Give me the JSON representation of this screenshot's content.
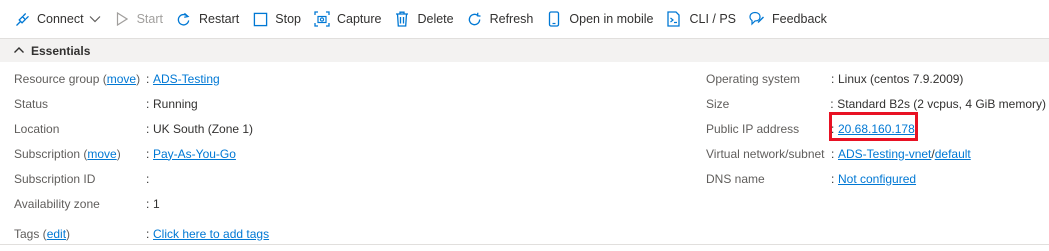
{
  "toolbar": {
    "connect": "Connect",
    "start": "Start",
    "restart": "Restart",
    "stop": "Stop",
    "capture": "Capture",
    "delete": "Delete",
    "refresh": "Refresh",
    "open_mobile": "Open in mobile",
    "cli": "CLI / PS",
    "feedback": "Feedback"
  },
  "essentials": {
    "title": "Essentials"
  },
  "left": {
    "resource_group": {
      "label": "Resource group (",
      "link": "move",
      "label_end": ")",
      "value": "ADS-Testing"
    },
    "status": {
      "label": "Status",
      "value": "Running"
    },
    "location": {
      "label": "Location",
      "value": "UK South (Zone 1)"
    },
    "subscription": {
      "label": "Subscription (",
      "link": "move",
      "label_end": ")",
      "value": "Pay-As-You-Go"
    },
    "subscription_id": {
      "label": "Subscription ID",
      "value": ""
    },
    "availability_zone": {
      "label": "Availability zone",
      "value": "1"
    },
    "tags": {
      "label": "Tags (",
      "link": "edit",
      "label_end": ")",
      "value": "Click here to add tags"
    }
  },
  "right": {
    "os": {
      "label": "Operating system",
      "value": "Linux (centos 7.9.2009)"
    },
    "size": {
      "label": "Size",
      "value": "Standard B2s (2 vcpus, 4 GiB memory)"
    },
    "public_ip": {
      "label": "Public IP address",
      "value": "20.68.160.178"
    },
    "vnet": {
      "label": "Virtual network/subnet",
      "value_a": "ADS-Testing-vnet",
      "separator": "/",
      "value_b": "default"
    },
    "dns": {
      "label": "DNS name",
      "value": "Not configured"
    }
  },
  "colon": ":",
  "colors": {
    "link": "#0078d4",
    "highlight": "#e81123",
    "text": "#323130",
    "label": "#605e5c"
  }
}
